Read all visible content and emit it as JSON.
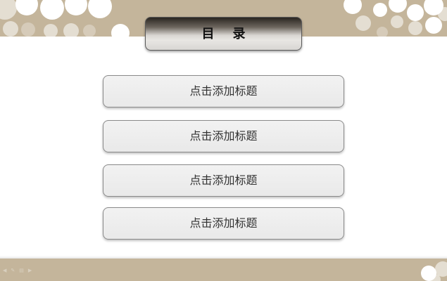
{
  "slide": {
    "title": "目录",
    "items": [
      {
        "label": "点击添加标题"
      },
      {
        "label": "点击添加标题"
      },
      {
        "label": "点击添加标题"
      },
      {
        "label": "点击添加标题"
      }
    ]
  },
  "colors": {
    "band": "#c4b59b",
    "background": "#ffffff",
    "item_fill": "#ececec",
    "item_border": "#8a8a8a",
    "title_dark": "#2a2520"
  }
}
